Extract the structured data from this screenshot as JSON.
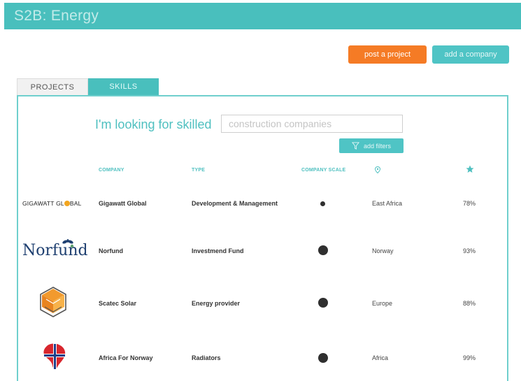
{
  "header": {
    "title": "S2B: Energy"
  },
  "actions": {
    "post_project": "post a project",
    "add_company": "add a company"
  },
  "tabs": [
    {
      "label": "PROJECTS",
      "active": false
    },
    {
      "label": "SKILLS",
      "active": true
    }
  ],
  "search": {
    "label": "I'm looking for skilled",
    "placeholder": "construction companies",
    "filter_button": "add filters"
  },
  "columns": {
    "company": "COMPANY",
    "type": "TYPE",
    "scale": "COMPANY SCALE",
    "location_icon": "location-pin-icon",
    "rating_icon": "star-icon"
  },
  "rows": [
    {
      "logo_text": "GIGAWATT GL BAL",
      "logo_parts": [
        "GIGAWATT GL",
        "BAL"
      ],
      "name": "Gigawatt Global",
      "type": "Development & Management",
      "scale": "small",
      "location": "East Africa",
      "rating": "78%"
    },
    {
      "logo_text": "Norfund",
      "name": "Norfund",
      "type": "Investmend Fund",
      "scale": "large",
      "location": "Norway",
      "rating": "93%"
    },
    {
      "logo_icon": "hexagon-cube-logo",
      "name": "Scatec Solar",
      "type": "Energy provider",
      "scale": "large",
      "location": "Europe",
      "rating": "88%"
    },
    {
      "logo_icon": "africa-norway-map-logo",
      "name": "Africa For Norway",
      "type": "Radiators",
      "scale": "large",
      "location": "Africa",
      "rating": "99%"
    }
  ],
  "colors": {
    "accent": "#49bfbd",
    "orange": "#f57b25",
    "dark": "#2f2f2f"
  }
}
